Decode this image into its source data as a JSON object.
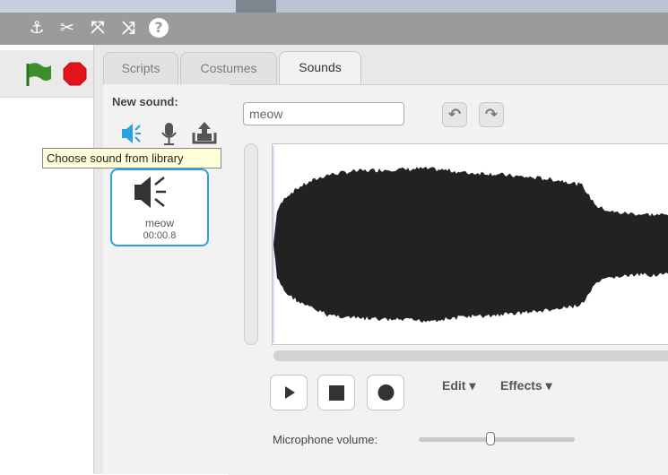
{
  "menubar": {
    "icons": [
      "duplicate-icon",
      "delete-icon",
      "grow-icon",
      "shrink-icon",
      "help-icon"
    ]
  },
  "stage": {
    "icons": [
      "green-flag-icon",
      "stop-icon"
    ]
  },
  "tabs": [
    {
      "label": "Scripts"
    },
    {
      "label": "Costumes"
    },
    {
      "label": "Sounds",
      "active": true
    }
  ],
  "sounds_panel": {
    "new_sound_label": "New sound:",
    "source_icons": [
      "sound-library-icon",
      "record-sound-icon",
      "upload-sound-icon"
    ],
    "tooltip": "Choose sound from library",
    "items": [
      {
        "name": "meow",
        "duration": "00:00.8",
        "selected": true
      }
    ]
  },
  "editor": {
    "name_value": "meow",
    "undo_icon": "undo-icon",
    "redo_icon": "redo-icon",
    "playback_icons": [
      "play-icon",
      "stop-icon",
      "record-icon"
    ],
    "edit_menu": "Edit ▾",
    "effects_menu": "Effects ▾",
    "mic_label": "Microphone volume:",
    "mic_volume": 0.46
  },
  "colors": {
    "menubar": "#9b9b9b",
    "selection": "#2aa1e0",
    "tooltip_bg": "#ffffd9",
    "waveform": "#222222",
    "green_flag": "#3a8f2a",
    "stop": "#e3131b"
  }
}
